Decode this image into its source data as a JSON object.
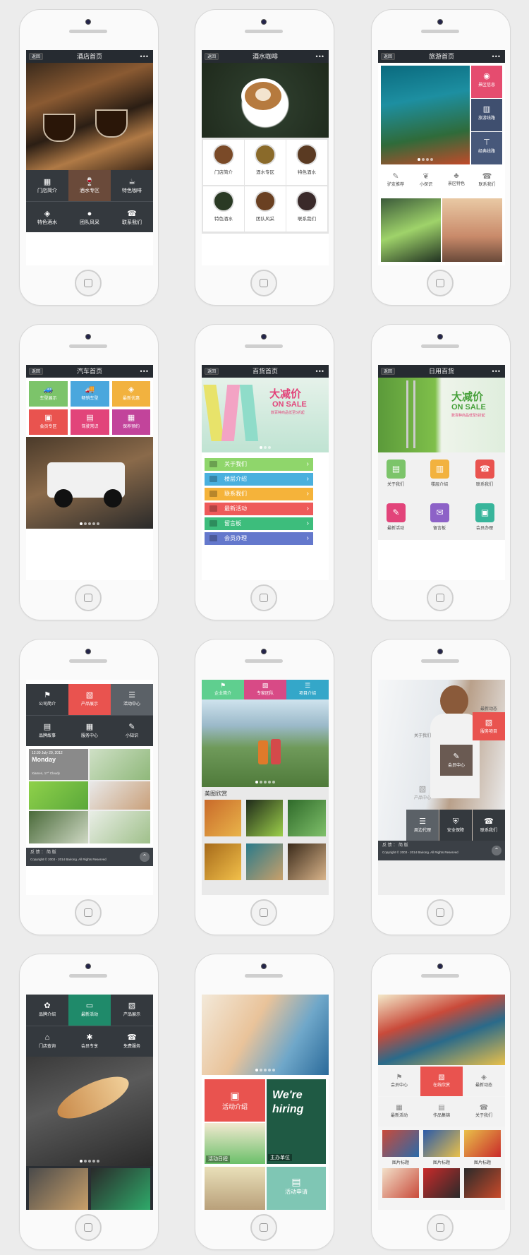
{
  "topbar": {
    "back_label": "返回",
    "more_label": "•••"
  },
  "p1": {
    "title": "酒店首页",
    "items": [
      "门店简介",
      "酒水专区",
      "特色咖啡",
      "特色酒水",
      "团队风采",
      "联系我们"
    ]
  },
  "p2": {
    "title": "酒水咖啡",
    "items": [
      "门店简介",
      "酒水专区",
      "特色酒水",
      "特色酒水",
      "团队风采",
      "联系我们"
    ]
  },
  "p3": {
    "title": "旅游首页",
    "side": [
      "景区信息",
      "旅游线路",
      "经典线路"
    ],
    "items": [
      "驴友推荐",
      "小探识",
      "景区特色",
      "联系我们"
    ]
  },
  "p4": {
    "title": "汽车首页",
    "items": [
      "车型展示",
      "畅销车型",
      "最新优惠",
      "会员专区",
      "驾驶常识",
      "保养预约"
    ]
  },
  "p5": {
    "title": "百货首页",
    "banner_big": "大减价",
    "banner_sale": "ON SALE",
    "banner_sub": "数百种商品低至5折起",
    "rows": [
      "关于我们",
      "楼层介绍",
      "联系我们",
      "最新活动",
      "留言板",
      "会员办理"
    ]
  },
  "p6": {
    "title": "日用百货",
    "banner_big": "大减价",
    "banner_sale": "ON SALE",
    "banner_sub": "数百种商品低至5折起",
    "items": [
      "关于我们",
      "楼层介绍",
      "联系我们",
      "最新活动",
      "留言板",
      "会员办理"
    ]
  },
  "p7": {
    "items": [
      "公司简介",
      "产品展示",
      "活动中心",
      "品牌故事",
      "服务中心",
      "小知识"
    ],
    "time": "12:30 July 29, 2012",
    "day": "Monday",
    "weather": "Xiamen, 17° Cloudy",
    "foot1": "反 馈 ： 简 版",
    "foot2": "Copyright © 2003 - 2014 Bairong. All Rights Reserved"
  },
  "p8": {
    "tabs": [
      "企业简介",
      "专家团队",
      "项目介绍"
    ],
    "gallery": "美图欣赏"
  },
  "p9": {
    "items": [
      "最新动态",
      "关于我们",
      "服务项目",
      "会员中心",
      "产品中心",
      "周边代理",
      "安全保障",
      "联系我们"
    ],
    "foot1": "反 馈 ： 简 版",
    "foot2": "Copyright © 2003 - 2014 Bairong. All Rights Reserved"
  },
  "p10": {
    "items": [
      "品牌介绍",
      "最新活动",
      "产品展示",
      "门店查询",
      "会员专享",
      "免费服务"
    ]
  },
  "p11": {
    "items": [
      "活动介绍",
      "活动日程",
      "主办单位",
      "活动申请"
    ],
    "hiring1": "We're",
    "hiring2": "hiring"
  },
  "p12": {
    "items": [
      "会员中心",
      "在线欣赏",
      "最新动态",
      "最新活动",
      "作品集锦",
      "关于我们"
    ],
    "pics": [
      "图片标题",
      "图片标题",
      "图片标题"
    ]
  },
  "colors": {
    "red": "#e9534f",
    "green": "#7cc46a",
    "blue": "#4aa7dd",
    "orange": "#f2b23f",
    "pink": "#e2447a",
    "purple": "#8d62c7",
    "dark": "#34393e",
    "teal": "#38b59b"
  }
}
